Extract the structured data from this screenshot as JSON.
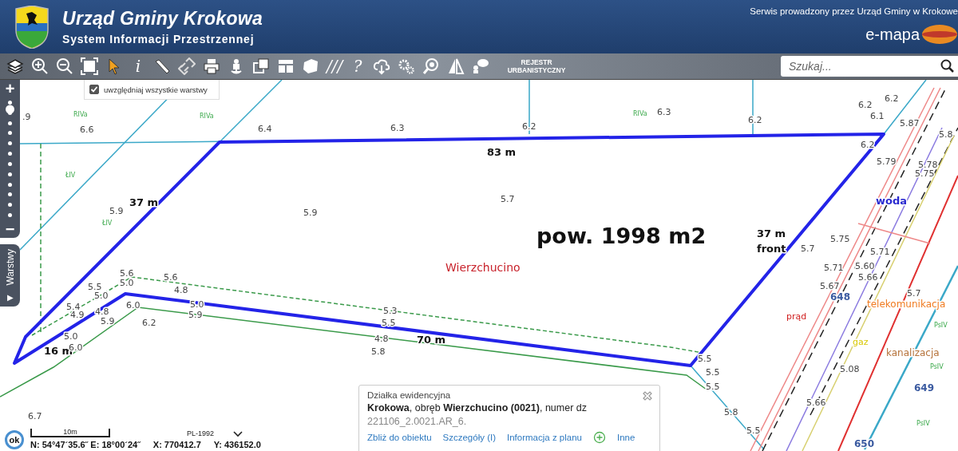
{
  "header": {
    "title": "Urząd Gminy Krokowa",
    "subtitle": "System Informacji Przestrzennej",
    "operator_note": "Serwis prowadzony przez Urząd Gminy w Krokowe",
    "brand": "e-mapa"
  },
  "toolbar": {
    "info_glyph": "i",
    "hatch_glyph": "///",
    "help_glyph": "?",
    "register_button": "REJESTR URBANISTYCZNY",
    "search": {
      "placeholder": "Szukaj..."
    }
  },
  "layers_option": {
    "label": "uwzględniaj wszystkie warstwy",
    "checked": true
  },
  "zoom_control": {
    "zoom_in": "+",
    "zoom_out": "−",
    "level": 0.9
  },
  "layers_tab": {
    "arrow": "▶",
    "label": "Warstwy"
  },
  "map": {
    "labels": [
      {
        "kind": "measure",
        "text": "83 m"
      },
      {
        "kind": "measure",
        "text": "37 m"
      },
      {
        "kind": "measure",
        "text": "37 m"
      },
      {
        "kind": "measure",
        "text": "front"
      },
      {
        "kind": "measure",
        "text": "70 m"
      },
      {
        "kind": "measure",
        "text": "16 m"
      },
      {
        "kind": "area",
        "text": "pow. 1998 m2"
      },
      {
        "kind": "locality",
        "text": "Wierzchucino"
      },
      {
        "kind": "water",
        "text": "woda"
      },
      {
        "kind": "telecom",
        "text": "telekomunikacja"
      },
      {
        "kind": "sewer",
        "text": "kanalizacja"
      },
      {
        "kind": "power",
        "text": "prąd"
      },
      {
        "kind": "gas",
        "text": "gaz"
      },
      {
        "kind": "parcel",
        "text": "648"
      },
      {
        "kind": "parcel",
        "text": "649"
      },
      {
        "kind": "parcel",
        "text": "650"
      },
      {
        "kind": "class",
        "text": "RIVa"
      },
      {
        "kind": "class",
        "text": "RIVa"
      },
      {
        "kind": "class",
        "text": "RIVa"
      },
      {
        "kind": "class",
        "text": "ŁIV"
      },
      {
        "kind": "class",
        "text": "ŁIV"
      },
      {
        "kind": "class",
        "text": "PsIV"
      },
      {
        "kind": "class",
        "text": "PsIV"
      },
      {
        "kind": "class",
        "text": "PsIV"
      },
      {
        "kind": "height",
        "text": "6.6"
      },
      {
        "kind": "height",
        "text": "6.4"
      },
      {
        "kind": "height",
        "text": "6.3"
      },
      {
        "kind": "height",
        "text": "6.2"
      },
      {
        "kind": "height",
        "text": "6.3"
      },
      {
        "kind": "height",
        "text": "6.2"
      },
      {
        "kind": "height",
        "text": "6.2"
      },
      {
        "kind": "height",
        "text": "6.2"
      },
      {
        "kind": "height",
        "text": "6.1"
      },
      {
        "kind": "height",
        "text": "5.87"
      },
      {
        "kind": "height",
        "text": "6.2"
      },
      {
        "kind": "height",
        "text": "5.79"
      },
      {
        "kind": "height",
        "text": "5.78"
      },
      {
        "kind": "height",
        "text": "5.75"
      },
      {
        "kind": "height",
        "text": "5.7"
      },
      {
        "kind": "height",
        "text": "5.9"
      },
      {
        "kind": "height",
        "text": "5.9"
      },
      {
        "kind": "height",
        "text": "5.7"
      },
      {
        "kind": "height",
        "text": "5.75"
      },
      {
        "kind": "height",
        "text": "5.71"
      },
      {
        "kind": "height",
        "text": "5.71"
      },
      {
        "kind": "height",
        "text": "5.60"
      },
      {
        "kind": "height",
        "text": "5.66"
      },
      {
        "kind": "height",
        "text": "5.67"
      },
      {
        "kind": "height",
        "text": "5.7"
      },
      {
        "kind": "height",
        "text": "5.6"
      },
      {
        "kind": "height",
        "text": "5.6"
      },
      {
        "kind": "height",
        "text": "5.5"
      },
      {
        "kind": "height",
        "text": "5.0"
      },
      {
        "kind": "height",
        "text": "4.8"
      },
      {
        "kind": "height",
        "text": "5.0"
      },
      {
        "kind": "height",
        "text": "5.4"
      },
      {
        "kind": "height",
        "text": "4.9"
      },
      {
        "kind": "height",
        "text": "4.8"
      },
      {
        "kind": "height",
        "text": "6.0"
      },
      {
        "kind": "height",
        "text": "5.0"
      },
      {
        "kind": "height",
        "text": "5.9"
      },
      {
        "kind": "height",
        "text": "5.9"
      },
      {
        "kind": "height",
        "text": "6.2"
      },
      {
        "kind": "height",
        "text": "5.0"
      },
      {
        "kind": "height",
        "text": "6.0"
      },
      {
        "kind": "height",
        "text": "5.3"
      },
      {
        "kind": "height",
        "text": "5.5"
      },
      {
        "kind": "height",
        "text": "4.8"
      },
      {
        "kind": "height",
        "text": "5.8"
      },
      {
        "kind": "height",
        "text": "5.5"
      },
      {
        "kind": "height",
        "text": "5.5"
      },
      {
        "kind": "height",
        "text": "5.5"
      },
      {
        "kind": "height",
        "text": "5.8"
      },
      {
        "kind": "height",
        "text": "5.5"
      },
      {
        "kind": "height",
        "text": "5.08"
      },
      {
        "kind": "height",
        "text": "5.66"
      },
      {
        "kind": "height",
        "text": ".9"
      },
      {
        "kind": "height",
        "text": "6.7"
      },
      {
        "kind": "height",
        "text": "5.8"
      }
    ]
  },
  "info_popup": {
    "title": "Działka ewidencyjna",
    "description": "**Krokowa**, obręb **Wierzchucino (0021)**, numer dz",
    "parcel_id": "221106_2.0021.AR_6.",
    "links": [
      "Zbliż do obiektu",
      "Szczegóły (I)",
      "Informacja z planu"
    ],
    "more_link": "Inne"
  },
  "status_bar": {
    "ok_button": "ok",
    "scale": "10m",
    "projection": "PL-1992",
    "geo_coords": "N: 54°47´35.6˝ E: 18°00´24˝",
    "x": "X: 770412.7",
    "y": "Y: 436152.0"
  }
}
